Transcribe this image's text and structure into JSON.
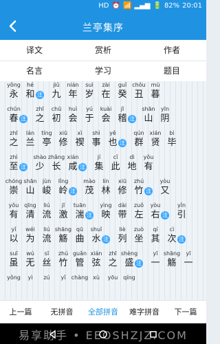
{
  "status": {
    "network": "HD",
    "battery": "82%",
    "time": "20:01"
  },
  "header": {
    "title": "兰亭集序",
    "back_icon": "chevron-left-icon"
  },
  "tabs": [
    {
      "label": "译文"
    },
    {
      "label": "赏析"
    },
    {
      "label": "作者"
    },
    {
      "label": "名言"
    },
    {
      "label": "学习"
    },
    {
      "label": "题目"
    }
  ],
  "text_lines": [
    [
      {
        "py": "yǒng",
        "hz": "永"
      },
      {
        "py": "hé",
        "hz": "和"
      },
      {
        "note": "注"
      },
      {
        "py": "jiǔ",
        "hz": "九"
      },
      {
        "py": "nián",
        "hz": "年"
      },
      {
        "py": "suì",
        "hz": "岁"
      },
      {
        "py": "zài",
        "hz": "在"
      },
      {
        "py": "guǐ",
        "hz": "癸"
      },
      {
        "py": "chǒu",
        "hz": "丑"
      },
      {
        "py": "mù",
        "hz": "暮"
      }
    ],
    [
      {
        "py": "chūn",
        "hz": "春"
      },
      {
        "note": "注"
      },
      {
        "py": "zhī",
        "hz": "之"
      },
      {
        "py": "chū",
        "hz": "初"
      },
      {
        "py": "huì",
        "hz": "会"
      },
      {
        "py": "yú",
        "hz": "于"
      },
      {
        "py": "kuài",
        "hz": "会"
      },
      {
        "py": "jī",
        "hz": "稽"
      },
      {
        "note": "注"
      },
      {
        "py": "shān",
        "hz": "山"
      },
      {
        "py": "yīn",
        "hz": "阴"
      }
    ],
    [
      {
        "py": "zhī",
        "hz": "之"
      },
      {
        "py": "lán",
        "hz": "兰"
      },
      {
        "py": "tíng",
        "hz": "亭"
      },
      {
        "py": "xiū",
        "hz": "修"
      },
      {
        "py": "xì",
        "hz": "禊"
      },
      {
        "py": "shì",
        "hz": "事"
      },
      {
        "py": "yě",
        "hz": "也"
      },
      {
        "note": "注"
      },
      {
        "py": "qún",
        "hz": "群"
      },
      {
        "py": "xián",
        "hz": "贤"
      },
      {
        "py": "bì",
        "hz": "毕"
      }
    ],
    [
      {
        "py": "zhì",
        "hz": "至"
      },
      {
        "note": "注"
      },
      {
        "py": "shào",
        "hz": "少"
      },
      {
        "py": "zhǎng",
        "hz": "长"
      },
      {
        "py": "xián",
        "hz": "咸"
      },
      {
        "note": "注"
      },
      {
        "py": "jí",
        "hz": "集"
      },
      {
        "py": "cǐ",
        "hz": "此"
      },
      {
        "py": "dì",
        "hz": "地"
      },
      {
        "py": "yǒu",
        "hz": "有"
      }
    ],
    [
      {
        "py": "chóng",
        "hz": "崇"
      },
      {
        "py": "shān",
        "hz": "山"
      },
      {
        "py": "jùn",
        "hz": "峻"
      },
      {
        "py": "lǐng",
        "hz": "岭"
      },
      {
        "note": "注"
      },
      {
        "py": "mào",
        "hz": "茂"
      },
      {
        "py": "lín",
        "hz": "林"
      },
      {
        "py": "xiū",
        "hz": "修"
      },
      {
        "py": "zhú",
        "hz": "竹"
      },
      {
        "note": "注"
      },
      {
        "py": "yòu",
        "hz": "又"
      }
    ],
    [
      {
        "py": "yǒu",
        "hz": "有"
      },
      {
        "py": "qīng",
        "hz": "清"
      },
      {
        "py": "liú",
        "hz": "流"
      },
      {
        "py": "jī",
        "hz": "激"
      },
      {
        "py": "tuān",
        "hz": "湍"
      },
      {
        "note": "注"
      },
      {
        "py": "yìng",
        "hz": "映"
      },
      {
        "py": "dài",
        "hz": "带"
      },
      {
        "py": "zuǒ",
        "hz": "左"
      },
      {
        "py": "yòu",
        "hz": "右"
      },
      {
        "note": "注"
      },
      {
        "py": "yǐn",
        "hz": "引"
      }
    ],
    [
      {
        "py": "yǐ",
        "hz": "以"
      },
      {
        "py": "wéi",
        "hz": "为"
      },
      {
        "py": "liú",
        "hz": "流"
      },
      {
        "py": "shāng",
        "hz": "觞"
      },
      {
        "py": "qū",
        "hz": "曲"
      },
      {
        "py": "shuǐ",
        "hz": "水"
      },
      {
        "note": "注"
      },
      {
        "py": "liè",
        "hz": "列"
      },
      {
        "py": "zuò",
        "hz": "坐"
      },
      {
        "py": "qí",
        "hz": "其"
      },
      {
        "py": "cì",
        "hz": "次"
      },
      {
        "note": "注"
      }
    ],
    [
      {
        "py": "suī",
        "hz": "虽"
      },
      {
        "py": "wú",
        "hz": "无"
      },
      {
        "py": "sī",
        "hz": "丝"
      },
      {
        "py": "zhú",
        "hz": "竹"
      },
      {
        "py": "guǎn",
        "hz": "管"
      },
      {
        "py": "xián",
        "hz": "弦"
      },
      {
        "py": "zhī",
        "hz": "之"
      },
      {
        "py": "shèng",
        "hz": "盛"
      },
      {
        "note": "注"
      },
      {
        "py": "yī",
        "hz": "一"
      },
      {
        "py": "shāng",
        "hz": "觞"
      },
      {
        "py": "yī",
        "hz": "一"
      }
    ],
    [
      {
        "py": "yǒng",
        "hz": ""
      },
      {
        "py": "yì",
        "hz": ""
      },
      {
        "py": "zú",
        "hz": ""
      },
      {
        "py": "yǐ",
        "hz": ""
      },
      {
        "py": "chàng",
        "hz": ""
      },
      {
        "py": "xù",
        "hz": ""
      },
      {
        "py": "yōu",
        "hz": ""
      },
      {
        "py": "qíng",
        "hz": ""
      }
    ]
  ],
  "bottom_buttons": [
    {
      "label": "上一篇",
      "active": false
    },
    {
      "label": "无拼音",
      "active": false
    },
    {
      "label": "全部拼音",
      "active": true
    },
    {
      "label": "难字拼音",
      "active": false
    },
    {
      "label": "下一篇",
      "active": false
    }
  ],
  "nav": {
    "watermark": "易享助手 • EEOSHZJZ.COM",
    "back_icon": "triangle-back-icon",
    "home_icon": "circle-home-icon",
    "recent_icon": "square-recent-icon"
  },
  "colors": {
    "primary": "#1f93e2",
    "note": "#3aa7ff"
  }
}
